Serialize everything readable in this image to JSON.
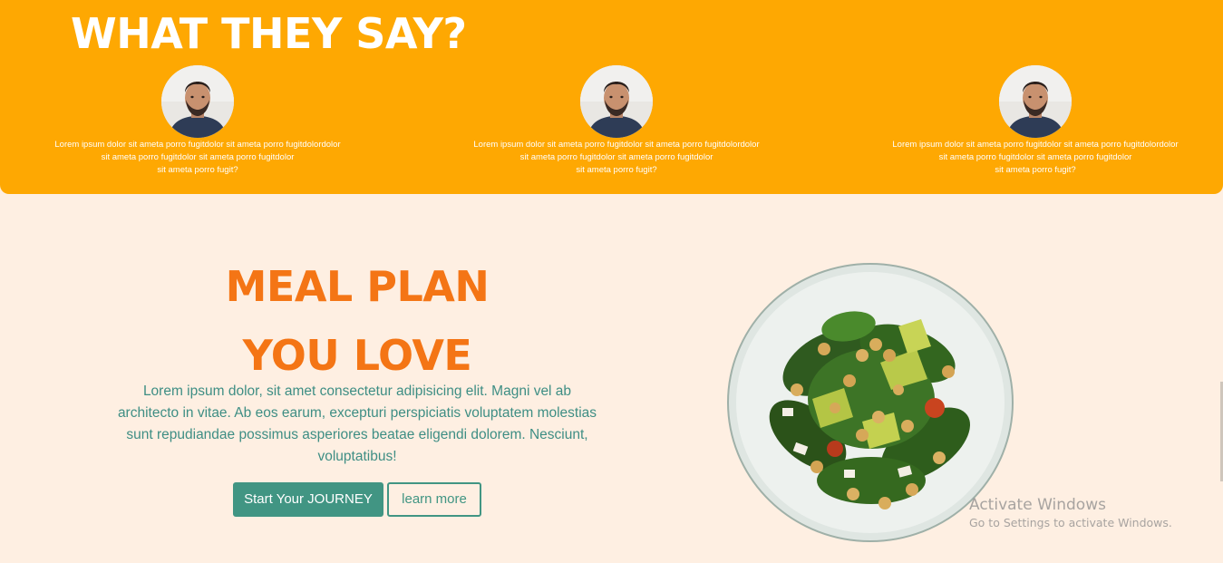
{
  "testimonials": {
    "title": "WHAT THEY SAY?",
    "cards": [
      {
        "avatar": "person-avatar",
        "lines": [
          "Lorem ipsum dolor sit ameta porro fugitdolor sit ameta porro fugitdolordolor",
          "sit ameta porro fugitdolor sit ameta porro fugitdolor",
          "sit ameta porro fugit?"
        ]
      },
      {
        "avatar": "person-avatar",
        "lines": [
          "Lorem ipsum dolor sit ameta porro fugitdolor sit ameta porro fugitdolordolor",
          "sit ameta porro fugitdolor sit ameta porro fugitdolor",
          "sit ameta porro fugit?"
        ]
      },
      {
        "avatar": "person-avatar",
        "lines": [
          "Lorem ipsum dolor sit ameta porro fugitdolor sit ameta porro fugitdolordolor",
          "sit ameta porro fugitdolor sit ameta porro fugitdolor",
          "sit ameta porro fugit?"
        ]
      }
    ]
  },
  "hero": {
    "title_line1": "MEAL PLAN",
    "title_line2": "YOU LOVE",
    "paragraph_lines": [
      "Lorem ipsum dolor, sit amet consectetur adipisicing elit. Magni vel ab",
      "architecto in vitae. Ab eos earum, excepturi perspiciatis voluptatem molestias",
      "sunt repudiandae possimus asperiores beatae eligendi dolorem. Nesciunt,",
      "voluptatibus!"
    ],
    "primary_button": "Start Your JOURNEY",
    "secondary_button": "learn more",
    "image": "salad-bowl-image"
  },
  "watermark": {
    "title": "Activate Windows",
    "subtitle": "Go to Settings to activate Windows."
  },
  "colors": {
    "testimonial_bg": "#fea802",
    "page_bg": "#feefe2",
    "heading_orange": "#f47515",
    "accent_teal": "#419583",
    "paragraph_teal": "#3e8e84"
  }
}
